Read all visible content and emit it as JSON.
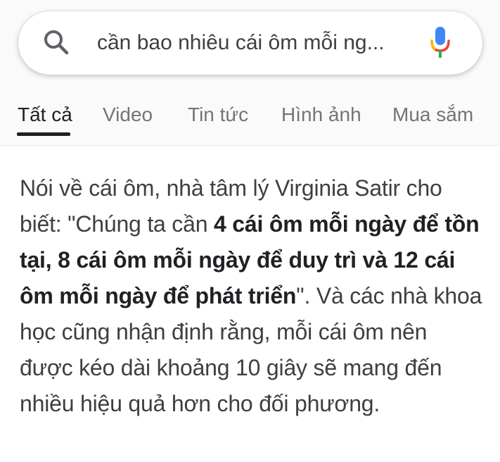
{
  "search": {
    "query": "cần bao nhiêu cái ôm mỗi ng..."
  },
  "icons": {
    "search": "search-icon",
    "mic": "microphone-icon"
  },
  "tabs": [
    {
      "label": "Tất cả",
      "active": true
    },
    {
      "label": "Video",
      "active": false
    },
    {
      "label": "Tin tức",
      "active": false
    },
    {
      "label": "Hình ảnh",
      "active": false
    },
    {
      "label": "Mua sắm",
      "active": false
    }
  ],
  "snippet": {
    "part1": "Nói về cái ôm, nhà tâm lý Virginia Satir cho biết: \"Chúng ta cần ",
    "bold": "4 cái ôm mỗi ngày để tồn tại, 8 cái ôm mỗi ngày để duy trì và 12 cái ôm mỗi ngày để phát triển",
    "part2": "\". Và các nhà khoa học cũng nhận định rằng, mỗi cái ôm nên được kéo dài khoảng 10 giây sẽ mang đến nhiều hiệu quả hơn cho đối phương."
  },
  "colors": {
    "mic_blue": "#4285F4",
    "mic_red": "#EA4335",
    "mic_yellow": "#FBBC05",
    "mic_green": "#34A853"
  }
}
